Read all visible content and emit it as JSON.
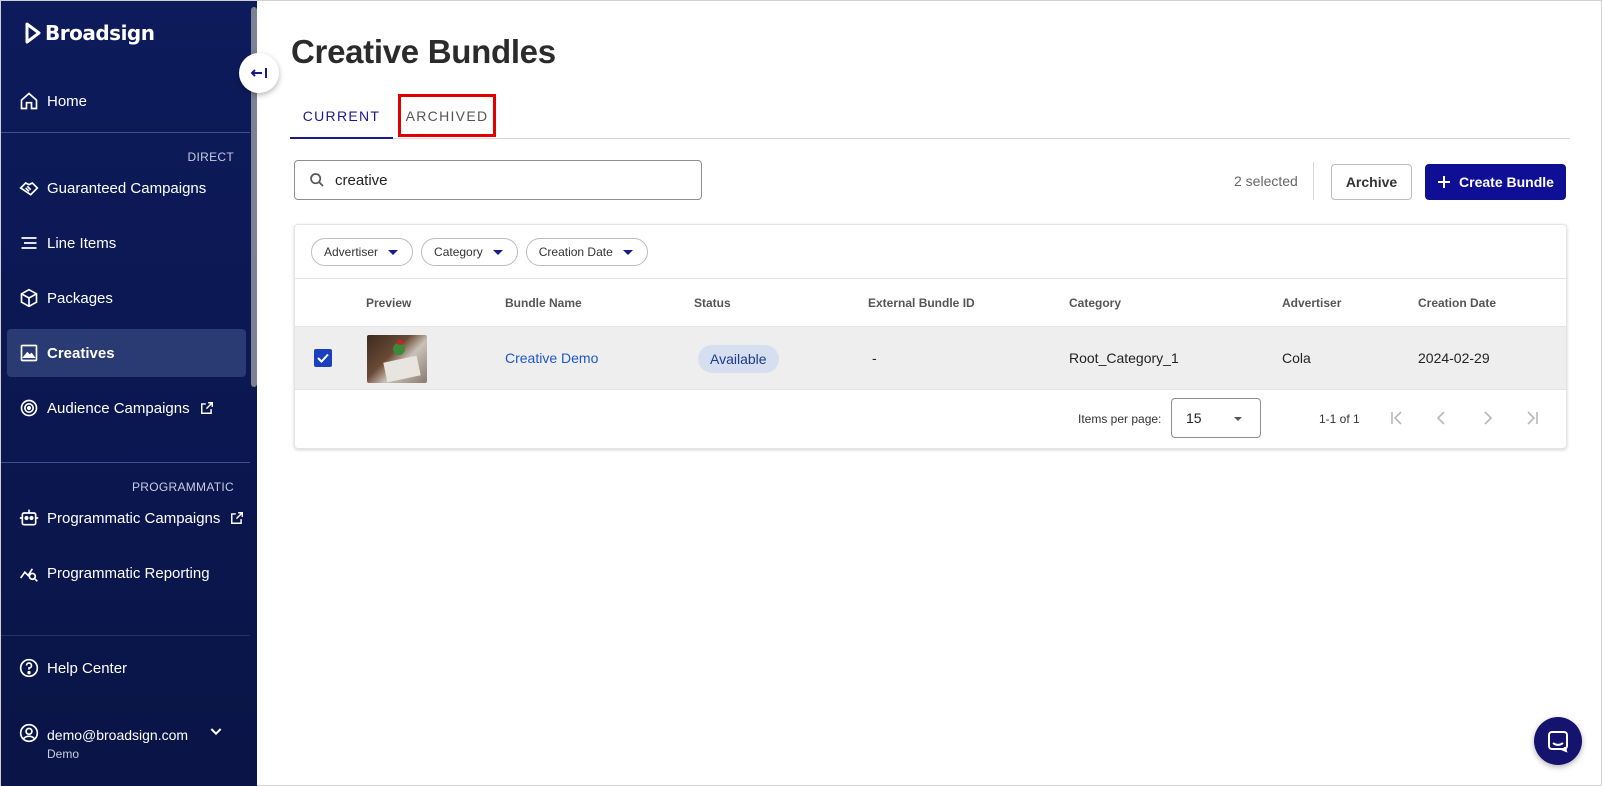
{
  "sidebar": {
    "brand": "Broadsign",
    "nav": {
      "home": "Home",
      "direct_section": "DIRECT",
      "guaranteed_campaigns": "Guaranteed Campaigns",
      "line_items": "Line Items",
      "packages": "Packages",
      "creatives": "Creatives",
      "audience_campaigns": "Audience Campaigns",
      "programmatic_section": "PROGRAMMATIC",
      "programmatic_campaigns": "Programmatic Campaigns",
      "programmatic_reporting": "Programmatic Reporting",
      "help_center": "Help Center"
    },
    "user": {
      "email": "demo@broadsign.com",
      "role": "Demo"
    }
  },
  "page": {
    "title": "Creative Bundles"
  },
  "tabs": {
    "current": "CURRENT",
    "archived": "ARCHIVED"
  },
  "search": {
    "value": "creative"
  },
  "toolbar": {
    "selected": "2 selected",
    "archive": "Archive",
    "create": "Create Bundle"
  },
  "filters": {
    "advertiser": "Advertiser",
    "category": "Category",
    "creation_date": "Creation Date"
  },
  "table": {
    "headers": {
      "preview": "Preview",
      "bundle_name": "Bundle Name",
      "status": "Status",
      "external_id": "External Bundle ID",
      "category": "Category",
      "advertiser": "Advertiser",
      "creation_date": "Creation Date"
    },
    "rows": [
      {
        "bundle_name": "Creative Demo",
        "status": "Available",
        "external_id": "-",
        "category": "Root_Category_1",
        "advertiser": "Cola",
        "creation_date": "2024-02-29"
      }
    ]
  },
  "pagination": {
    "items_per_page_label": "Items per page:",
    "items_per_page": "15",
    "range": "1-1 of 1"
  },
  "colors": {
    "sidebar": "#0d1b5c",
    "accent": "#0f0f96",
    "tab_highlight": "#e00000",
    "link": "#1e56c8"
  }
}
